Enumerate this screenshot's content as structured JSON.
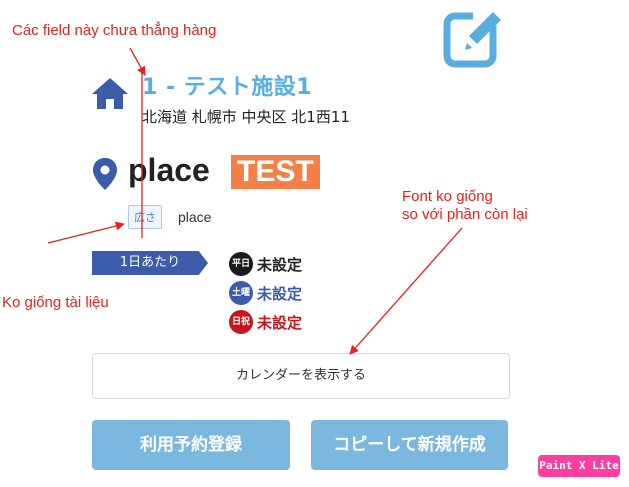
{
  "facility": {
    "title": "1 - テスト施設1",
    "address": "北海道 札幌市 中央区 北1西11",
    "place_name": "place",
    "place_badge": "TEST",
    "size_tag": "広さ",
    "size_value": "place"
  },
  "pricing": {
    "ribbon_label": "1日あたり",
    "days": [
      {
        "badge": "平日",
        "value": "未設定",
        "badge_color": "#1a1a1a",
        "value_color": "#222222"
      },
      {
        "badge": "土曜",
        "value": "未設定",
        "badge_color": "#3b5ca8",
        "value_color": "#3b5ca8"
      },
      {
        "badge": "日祝",
        "value": "未設定",
        "badge_color": "#c4161c",
        "value_color": "#c4161c"
      }
    ]
  },
  "buttons": {
    "calendar": "カレンダーを表示する",
    "register": "利用予約登録",
    "copy": "コピーして新規作成"
  },
  "annotations": {
    "not_aligned": "Các field này chưa thẳng hàng",
    "font_line1": "Font ko giống",
    "font_line2": "so với phần còn lại",
    "not_like_doc": "Ko giống tài liệu"
  },
  "watermark": "Paint X Lite",
  "colors": {
    "accent": "#5aaedf",
    "navy": "#3b5ca8",
    "badge_orange": "#f47f47",
    "annotation_red": "#e5211d"
  },
  "icons": {
    "edit": "edit-icon",
    "home": "home-icon",
    "pin": "map-pin-icon"
  }
}
